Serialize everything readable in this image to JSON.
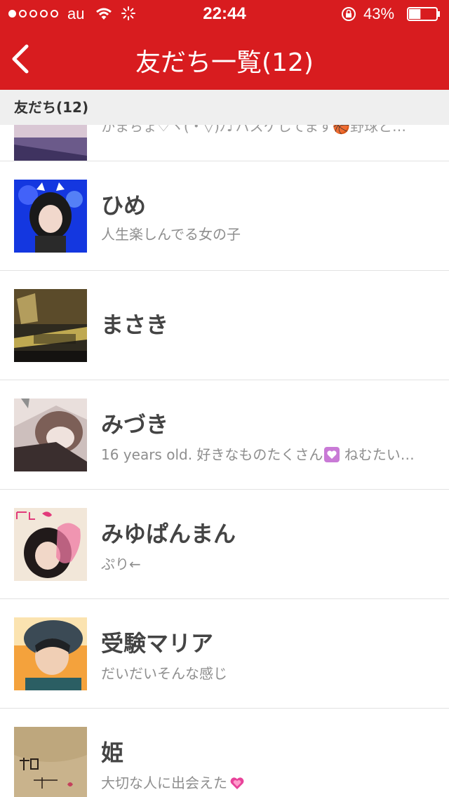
{
  "status_bar": {
    "carrier": "au",
    "time": "22:44",
    "battery_percent": "43%",
    "battery_level": 0.43,
    "signal_bars": 1
  },
  "nav": {
    "title": "友だち一覧(12)",
    "back_icon": "chevron-left-icon"
  },
  "section": {
    "title": "友だち(12)"
  },
  "partial_row": {
    "message": "かまちょ♡ヽ(・▽)ﾉ♪バスケしてます🏀野球と…"
  },
  "friends": [
    {
      "name": "ひめ",
      "message": "人生楽しんでる女の子",
      "has_heart": false
    },
    {
      "name": "まさき",
      "message": "",
      "has_heart": false
    },
    {
      "name": "みづき",
      "message": "16 years old. 好きなものたくさん",
      "message_after": " ねむたい…",
      "has_heart": true
    },
    {
      "name": "みゆぱんまん",
      "message": "ぷり←",
      "has_heart": false
    },
    {
      "name": "受験マリア",
      "message": "だいだいそんな感じ",
      "has_heart": false
    },
    {
      "name": "姫",
      "message": "大切な人に出会えた",
      "has_heart": true
    }
  ],
  "colors": {
    "header_red": "#d81c1f",
    "section_bg": "#efefef",
    "name_text": "#444444",
    "message_text": "#8e8e8e",
    "heart_pink": "#e8439a"
  }
}
